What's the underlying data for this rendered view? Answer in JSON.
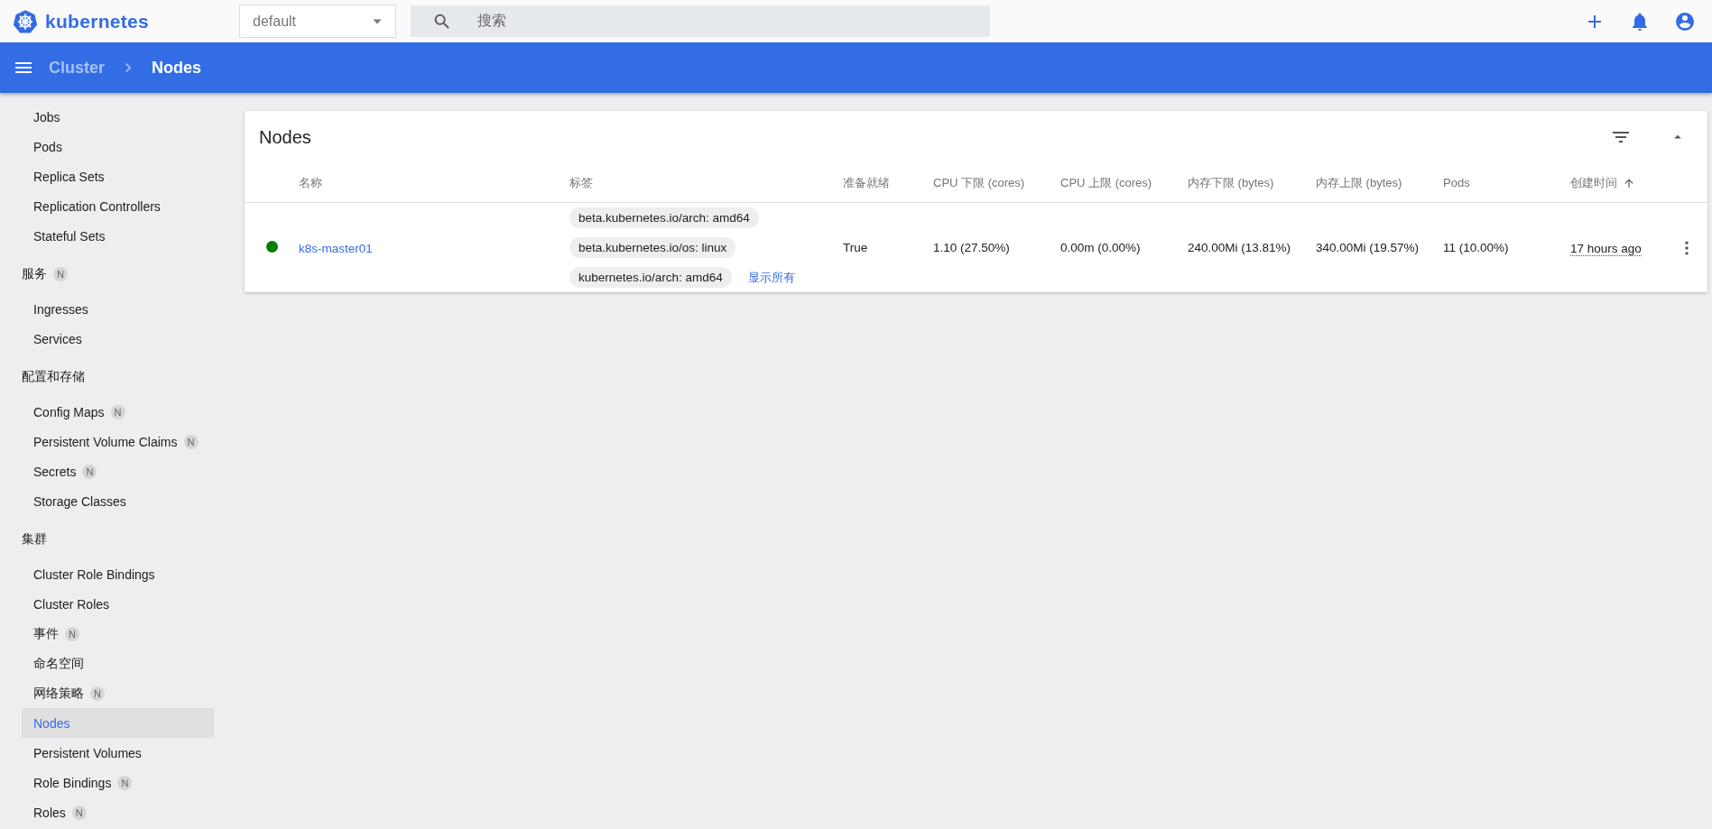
{
  "top_bar": {
    "logo_text": "kubernetes",
    "namespace": {
      "value": "default"
    },
    "search": {
      "placeholder": "搜索"
    }
  },
  "breadcrumb": [
    {
      "label": "Cluster",
      "current": false
    },
    {
      "label": "Nodes",
      "current": true
    }
  ],
  "sidebar": {
    "items": [
      {
        "kind": "item",
        "label": "Jobs",
        "selected": false
      },
      {
        "kind": "item",
        "label": "Pods",
        "selected": false
      },
      {
        "kind": "item",
        "label": "Replica Sets",
        "selected": false
      },
      {
        "kind": "item",
        "label": "Replication Controllers",
        "selected": false
      },
      {
        "kind": "item",
        "label": "Stateful Sets",
        "selected": false
      },
      {
        "kind": "header",
        "label": "服务",
        "badge": "N"
      },
      {
        "kind": "item",
        "label": "Ingresses",
        "selected": false
      },
      {
        "kind": "item",
        "label": "Services",
        "selected": false
      },
      {
        "kind": "header",
        "label": "配置和存储"
      },
      {
        "kind": "item",
        "label": "Config Maps",
        "badge": "N",
        "selected": false
      },
      {
        "kind": "item",
        "label": "Persistent Volume Claims",
        "badge": "N",
        "selected": false
      },
      {
        "kind": "item",
        "label": "Secrets",
        "badge": "N",
        "selected": false
      },
      {
        "kind": "item",
        "label": "Storage Classes",
        "selected": false
      },
      {
        "kind": "header",
        "label": "集群"
      },
      {
        "kind": "item",
        "label": "Cluster Role Bindings",
        "selected": false
      },
      {
        "kind": "item",
        "label": "Cluster Roles",
        "selected": false
      },
      {
        "kind": "item",
        "label": "事件",
        "badge": "N",
        "selected": false
      },
      {
        "kind": "item",
        "label": "命名空间",
        "selected": false
      },
      {
        "kind": "item",
        "label": "网络策略",
        "badge": "N",
        "selected": false
      },
      {
        "kind": "item",
        "label": "Nodes",
        "selected": true
      },
      {
        "kind": "item",
        "label": "Persistent Volumes",
        "selected": false
      },
      {
        "kind": "item",
        "label": "Role Bindings",
        "badge": "N",
        "selected": false
      },
      {
        "kind": "item",
        "label": "Roles",
        "badge": "N",
        "selected": false
      }
    ]
  },
  "card": {
    "title": "Nodes",
    "columns": [
      {
        "label": "名称",
        "sorted": false
      },
      {
        "label": "标签",
        "sorted": false
      },
      {
        "label": "准备就绪",
        "sorted": false
      },
      {
        "label": "CPU 下限 (cores)",
        "sorted": false
      },
      {
        "label": "CPU 上限 (cores)",
        "sorted": false
      },
      {
        "label": "内存下限 (bytes)",
        "sorted": false
      },
      {
        "label": "内存上限 (bytes)",
        "sorted": false
      },
      {
        "label": "Pods",
        "sorted": false
      },
      {
        "label": "创建时间",
        "sorted": true
      }
    ],
    "rows": [
      {
        "color": "#008000",
        "name": "k8s-master01",
        "labels": [
          "beta.kubernetes.io/arch: amd64",
          "beta.kubernetes.io/os: linux",
          "kubernetes.io/arch: amd64"
        ],
        "show_all": "显示所有",
        "ready": "True",
        "cpu_requests": "1.10 (27.50%)",
        "cpu_limits": "0.00m (0.00%)",
        "memory_requests": "240.00Mi (13.81%)",
        "memory_limits": "340.00Mi (19.57%)",
        "pods": "11 (10.00%)",
        "created": "17 hours ago"
      }
    ]
  }
}
